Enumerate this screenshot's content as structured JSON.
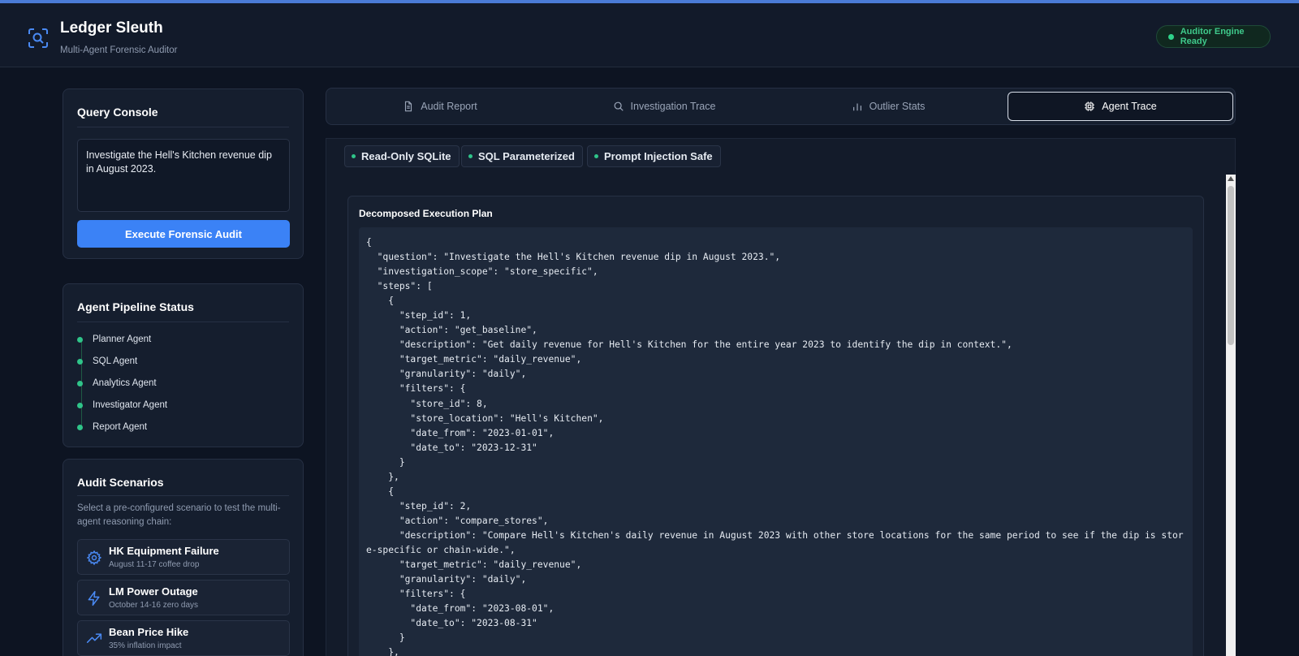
{
  "app": {
    "title": "Ledger Sleuth",
    "subtitle": "Multi-Agent Forensic Auditor",
    "status": "Auditor Engine Ready",
    "accent_color": "#3b82f6",
    "status_color": "#2fd38a"
  },
  "query_console": {
    "title": "Query Console",
    "query": "Investigate the Hell's Kitchen revenue dip in August 2023.",
    "execute_label": "Execute Forensic Audit"
  },
  "pipeline": {
    "title": "Agent Pipeline Status",
    "agents": [
      "Planner Agent",
      "SQL Agent",
      "Analytics Agent",
      "Investigator Agent",
      "Report Agent"
    ]
  },
  "scenarios": {
    "title": "Audit Scenarios",
    "description": "Select a pre-configured scenario to test the multi-agent reasoning chain:",
    "items": [
      {
        "title": "HK Equipment Failure",
        "subtitle": "August 11-17 coffee drop",
        "icon": "gear-icon"
      },
      {
        "title": "LM Power Outage",
        "subtitle": "October 14-16 zero days",
        "icon": "lightning-icon"
      },
      {
        "title": "Bean Price Hike",
        "subtitle": "35% inflation impact",
        "icon": "trend-up-icon"
      }
    ]
  },
  "tabs": [
    {
      "label": "Audit Report",
      "icon": "document-icon"
    },
    {
      "label": "Investigation Trace",
      "icon": "search-icon"
    },
    {
      "label": "Outlier Stats",
      "icon": "bar-chart-icon"
    },
    {
      "label": "Agent Trace",
      "icon": "chip-icon",
      "active": true
    }
  ],
  "badges": [
    "Read-Only SQLite",
    "SQL Parameterized",
    "Prompt Injection Safe"
  ],
  "plan": {
    "title": "Decomposed Execution Plan",
    "code": "{\n  \"question\": \"Investigate the Hell's Kitchen revenue dip in August 2023.\",\n  \"investigation_scope\": \"store_specific\",\n  \"steps\": [\n    {\n      \"step_id\": 1,\n      \"action\": \"get_baseline\",\n      \"description\": \"Get daily revenue for Hell's Kitchen for the entire year 2023 to identify the dip in context.\",\n      \"target_metric\": \"daily_revenue\",\n      \"granularity\": \"daily\",\n      \"filters\": {\n        \"store_id\": 8,\n        \"store_location\": \"Hell's Kitchen\",\n        \"date_from\": \"2023-01-01\",\n        \"date_to\": \"2023-12-31\"\n      }\n    },\n    {\n      \"step_id\": 2,\n      \"action\": \"compare_stores\",\n      \"description\": \"Compare Hell's Kitchen's daily revenue in August 2023 with other store locations for the same period to see if the dip is store-specific or chain-wide.\",\n      \"target_metric\": \"daily_revenue\",\n      \"granularity\": \"daily\",\n      \"filters\": {\n        \"date_from\": \"2023-08-01\",\n        \"date_to\": \"2023-08-31\"\n      }\n    },"
  }
}
